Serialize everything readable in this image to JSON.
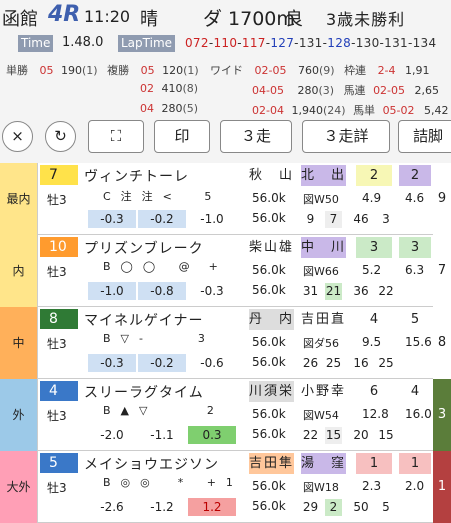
{
  "header": {
    "venue": "函館",
    "race": "4R",
    "time": "11:20",
    "weather": "晴",
    "course": "ダ 1700m",
    "condition": "良",
    "race_class": "3歳未勝利",
    "time_tag": "Time",
    "finish_time": "1.48.0",
    "lap_tag": "LapTime",
    "laps": [
      "072",
      "110",
      "117",
      "127",
      "131",
      "128",
      "130",
      "131",
      "134"
    ],
    "lap_colors": [
      "r",
      "r",
      "r",
      "b",
      "s",
      "b",
      "s",
      "s",
      "s"
    ]
  },
  "payouts": {
    "row1": {
      "tan_label": "単勝",
      "tan_combo": "05",
      "tan_value": "190",
      "tan_pop": "(1)",
      "fuku_label": "複勝",
      "fuku_combo": "05",
      "fuku_value": "120",
      "fuku_pop": "(1)",
      "wide_label": "ワイド",
      "wide_combo": "02-05",
      "wide_value": "760",
      "wide_pop": "(9)",
      "waku_label": "枠連",
      "waku_combo": "2-4",
      "waku_value": "1,91"
    },
    "row2": {
      "fuku_combo": "02",
      "fuku_value": "410",
      "fuku_pop": "(8)",
      "wide_combo": "04-05",
      "wide_value": "280",
      "wide_pop": "(3)",
      "uma_label": "馬連",
      "uma_combo": "02-05",
      "uma_value": "2,65"
    },
    "row3": {
      "fuku_combo": "04",
      "fuku_value": "280",
      "fuku_pop": "(5)",
      "wide_combo": "02-04",
      "wide_value": "1,940",
      "wide_pop": "(24)",
      "uma_label": "馬単",
      "uma_combo": "05-02",
      "uma_value": "5,42"
    }
  },
  "toolbar": {
    "close_icon": "×",
    "refresh_icon": "↻",
    "expand_icon": "⛶",
    "print_label": "印",
    "run3_label": "３走",
    "run3_detail_label": "３走詳",
    "detail_label": "詰脚"
  },
  "horses": [
    {
      "pos": "最内",
      "pos_color": "#ffe58a",
      "num": "7",
      "num_color": "#ffe24a",
      "sex": "牡3",
      "name": "ヴィンチトーレ",
      "marks": "C  注  注  <       5",
      "v1": "-0.3",
      "v2": "-0.2",
      "v3": "-1.0",
      "v1c": "#cfe0f3",
      "v2c": "#cfe0f3",
      "v3c": "",
      "jockey": "秋　山",
      "jc": "#fff",
      "trainer": "北　出",
      "tc": "#c9b8e8",
      "odds1": "2",
      "odds1c": "#f7f7b5",
      "odds2": "2",
      "odds2c": "#c9b8e8",
      "side": "9",
      "sidec": "#fff",
      "w1": "56.0k",
      "w2": "56.0k",
      "m1": "図W50",
      "m2": "4.9",
      "m3": "4.6",
      "sq": [
        "9",
        "7",
        "46",
        "3"
      ],
      "sqc": [
        "",
        "#eee",
        "",
        ""
      ]
    },
    {
      "pos": "内",
      "pos_color": "#ffe58a",
      "num": "10",
      "num_color": "#ff9b2e",
      "sex": "牡3",
      "name": "プリズンブレーク",
      "marks": "B  ◯  ◯     @    +",
      "v1": "-1.0",
      "v2": "-0.8",
      "v3": "-0.3",
      "v1c": "#cfe0f3",
      "v2c": "#cfe0f3",
      "v3c": "",
      "jockey": "柴山雄",
      "jc": "#fff",
      "trainer": "中　川",
      "tc": "#c9b8e8",
      "odds1": "3",
      "odds1c": "#cbeac7",
      "odds2": "3",
      "odds2c": "#cbeac7",
      "side": "7",
      "sidec": "#fff",
      "w1": "56.0k",
      "w2": "56.0k",
      "m1": "図W66",
      "m2": "5.2",
      "m3": "6.3",
      "sq": [
        "31",
        "21",
        "36",
        "22"
      ],
      "sqc": [
        "",
        "#cbeac7",
        "",
        ""
      ]
    },
    {
      "pos": "中",
      "pos_color": "#ffb05a",
      "num": "8",
      "num_color": "#2f7a35",
      "sex": "牡3",
      "name": "マイネルゲイナー",
      "marks": "B  ▽  -            3",
      "v1": "-0.3",
      "v2": "-0.2",
      "v3": "-0.6",
      "v1c": "#cfe0f3",
      "v2c": "#cfe0f3",
      "v3c": "",
      "jockey": "丹　内",
      "jc": "#ddd",
      "trainer": "吉田直",
      "tc": "#fff",
      "odds1": "4",
      "odds1c": "#fff",
      "odds2": "5",
      "odds2c": "#fff",
      "side": "8",
      "sidec": "#fff",
      "w1": "56.0k",
      "w2": "56.0k",
      "m1": "図ダ56",
      "m2": "9.5",
      "m3": "15.6",
      "sq": [
        "26",
        "25",
        "16",
        "25"
      ],
      "sqc": [
        "",
        "",
        "",
        ""
      ]
    },
    {
      "pos": "外",
      "pos_color": "#9cc9e8",
      "num": "4",
      "num_color": "#3a78c8",
      "sex": "牡3",
      "name": "スリーラグタイム",
      "marks": "B  ▲  ▽             2",
      "v1": "-2.0",
      "v2": "-1.1",
      "v3": "0.3",
      "v1c": "",
      "v2c": "",
      "v3c": "#7fcf6f",
      "jockey": "川須栄",
      "jc": "#ddd",
      "trainer": "小野幸",
      "tc": "#fff",
      "odds1": "6",
      "odds1c": "#fff",
      "odds2": "4",
      "odds2c": "#fff",
      "side": "3",
      "sidec": "#5b7d3a",
      "w1": "56.0k",
      "w2": "56.0k",
      "m1": "図W54",
      "m2": "12.8",
      "m3": "16.0",
      "sq": [
        "22",
        "15",
        "20",
        "15"
      ],
      "sqc": [
        "",
        "#eee",
        "",
        ""
      ]
    },
    {
      "pos": "大外",
      "pos_color": "#ff9fb6",
      "num": "5",
      "num_color": "#3a78c8",
      "sex": "牡3",
      "name": "メイショウエジソン",
      "marks": "B  ◎  ◎      *     +  1",
      "v1": "-2.6",
      "v2": "-1.2",
      "v3": "1.2",
      "v1c": "",
      "v2c": "",
      "v3c": "#f5a0a0",
      "jockey": "吉田隼",
      "jc": "#ffc79b",
      "trainer": "湯　窪",
      "tc": "#c9b8e8",
      "odds1": "1",
      "odds1c": "#f7c0c0",
      "odds2": "1",
      "odds2c": "#f7c0c0",
      "side": "1",
      "sidec": "#b44040",
      "w1": "56.0k",
      "w2": "56.0k",
      "m1": "図W18",
      "m2": "2.3",
      "m3": "2.0",
      "sq": [
        "29",
        "2",
        "50",
        "5"
      ],
      "sqc": [
        "",
        "#cbeac7",
        "",
        ""
      ]
    }
  ]
}
